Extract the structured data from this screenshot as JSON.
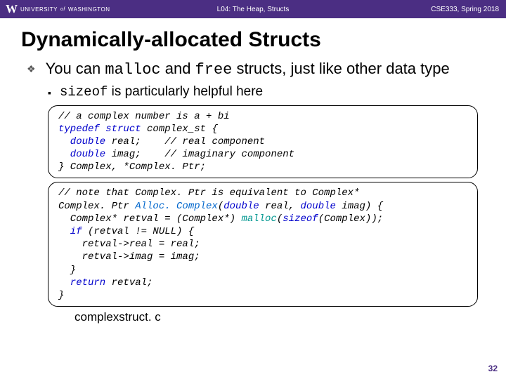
{
  "header": {
    "logo_w": "W",
    "logo_univ": "UNIVERSITY",
    "logo_of": "of",
    "logo_wash": "WASHINGTON",
    "lecture": "L04: The Heap, Structs",
    "course": "CSE333, Spring 2018"
  },
  "title": "Dynamically-allocated Structs",
  "bullet1_pre": "You can ",
  "bullet1_malloc": "malloc",
  "bullet1_mid": " and ",
  "bullet1_free": "free",
  "bullet1_post": " structs, just like other data type",
  "bullet2_sizeof": "sizeof",
  "bullet2_post": " is particularly helpful here",
  "code1": {
    "l1": "// a complex number is a + bi",
    "l2a": "typedef struct",
    "l2b": " complex_st {",
    "l3a": "  double",
    "l3b": " real;    // real component",
    "l4a": "  double",
    "l4b": " imag;    // imaginary component",
    "l5": "} Complex, *Complex. Ptr;"
  },
  "code2": {
    "l1": "// note that Complex. Ptr is equivalent to Complex*",
    "l2a": "Complex. Ptr ",
    "l2b": "Alloc. Complex",
    "l2c": "(",
    "l2d": "double",
    "l2e": " real, ",
    "l2f": "double",
    "l2g": " imag) {",
    "l3a": "  Complex* retval = (Complex*) ",
    "l3b": "malloc",
    "l3c": "(",
    "l3d": "sizeof",
    "l3e": "(Complex));",
    "l4a": "  if",
    "l4b": " (retval != NULL) {",
    "l5": "    retval->real = real;",
    "l6": "    retval->imag = imag;",
    "l7": "  }",
    "l8a": "  return",
    "l8b": " retval;",
    "l9": "}"
  },
  "filename": "complexstruct. c",
  "pagenum": "32"
}
